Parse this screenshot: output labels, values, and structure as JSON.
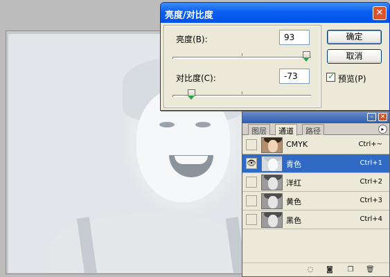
{
  "dialog": {
    "title": "亮度/对比度",
    "close_glyph": "✕",
    "brightness": {
      "label": "亮度(B):",
      "value": "93",
      "level": 93,
      "range": [
        -100,
        100
      ]
    },
    "contrast": {
      "label": "对比度(C):",
      "value": "-73",
      "level": -73,
      "range": [
        -100,
        100
      ]
    },
    "ok_label": "确定",
    "cancel_label": "取消",
    "preview_label": "预览(P)",
    "preview_checked": true
  },
  "channels_panel": {
    "tabs": [
      "图层",
      "通道",
      "路径"
    ],
    "active_tab": "通道",
    "minimize_glyph": "–",
    "close_glyph": "✕",
    "menu_glyph": "▸",
    "rows": [
      {
        "name": "CMYK",
        "shortcut": "Ctrl+~",
        "visible": false,
        "selected": false,
        "thumb": "color"
      },
      {
        "name": "青色",
        "shortcut": "Ctrl+1",
        "visible": true,
        "selected": true,
        "thumb": "cyan"
      },
      {
        "name": "洋红",
        "shortcut": "Ctrl+2",
        "visible": false,
        "selected": false,
        "thumb": "gray"
      },
      {
        "name": "黄色",
        "shortcut": "Ctrl+3",
        "visible": false,
        "selected": false,
        "thumb": "gray"
      },
      {
        "name": "黑色",
        "shortcut": "Ctrl+4",
        "visible": false,
        "selected": false,
        "thumb": "gray"
      }
    ],
    "bottom_icons": [
      "load-selection-icon",
      "save-selection-icon",
      "new-channel-icon",
      "delete-channel-icon"
    ]
  },
  "colors": {
    "title_bar": "#0a5ff1",
    "selection": "#316ac5",
    "dialog_bg": "#ece9d8"
  }
}
